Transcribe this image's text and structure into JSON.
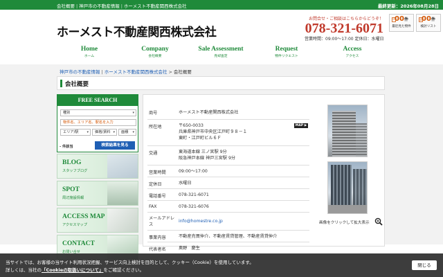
{
  "topbar": {
    "links": [
      "会社概要",
      "神戸市の不動産情報",
      "ホーメスト不動産関西株式会社"
    ],
    "updated": "最終更新：2026年08月28日"
  },
  "header": {
    "logo": "ホーメスト不動産関西株式会社",
    "contact_note": "お問合せ・ご相談はこちらからどうぞ！",
    "tel": "078-321-6071",
    "hours": "営業時間：09:00〜17:00 定休日：水曜日"
  },
  "counters": [
    {
      "num": "00",
      "unit": "件",
      "label": "最近見た物件",
      "icon": "history-icon"
    },
    {
      "num": "00",
      "unit": "件",
      "label": "検討リスト",
      "icon": "list-icon"
    }
  ],
  "gnav": [
    {
      "en": "Home",
      "jp": "ホーム"
    },
    {
      "en": "Company",
      "jp": "会社概要"
    },
    {
      "en": "Sale Assessment",
      "jp": "売却査定"
    },
    {
      "en": "Request",
      "jp": "物件リクエスト"
    },
    {
      "en": "Access",
      "jp": "アクセス"
    }
  ],
  "breadcrumb": {
    "items": [
      "神戸市の不動産情報",
      "ホーメスト不動産関西株式会社"
    ],
    "current": "会社概要"
  },
  "page_title": "会社概要",
  "search": {
    "title": "FREE SEARCH",
    "type_placeholder": "種別",
    "keyword_placeholder": "物件名、エリア名、駅名を入力",
    "area_placeholder": "エリア/駅",
    "price_label": "価格/賃料",
    "size_label": "面積",
    "condition_label": "- 件該当",
    "button": "検索結果を見る"
  },
  "banners": [
    {
      "en": "BLOG",
      "jp": "スタッフブログ"
    },
    {
      "en": "SPOT",
      "jp": "周辺施設情報"
    },
    {
      "en": "ACCESS MAP",
      "jp": "アクセスマップ"
    },
    {
      "en": "CONTACT",
      "jp": "お問い合せ"
    }
  ],
  "company_info": [
    {
      "key": "商号",
      "value": "ホーメスト不動産関西株式会社"
    },
    {
      "key": "所在地",
      "value": "〒650-0033\n兵庫県神戸市中央区江戸町９８－１\n東町・江戸町ビル６Ｆ",
      "map": "MAP"
    },
    {
      "key": "交通",
      "value": "東海道本線 三ノ宮駅 9分\n阪急神戸本線 神戸三宮駅 9分"
    },
    {
      "key": "営業時間",
      "value": "09:00〜17:00"
    },
    {
      "key": "定休日",
      "value": "水曜日"
    },
    {
      "key": "電話番号",
      "value": "078-321-6071"
    },
    {
      "key": "FAX",
      "value": "078-321-6076"
    },
    {
      "key": "メールアドレス",
      "value": "info@homestre.co.jp"
    },
    {
      "key": "事業内容",
      "value": "不動産売買仲介、不動産賃貸管理、不動産賃貸仲介"
    },
    {
      "key": "代表者名",
      "value": "奥野　慶生"
    }
  ],
  "photo_caption": "画像をクリックして拡大表示",
  "cookie": {
    "line1": "当サイトでは、お客様の当サイト利用状況把握、サービス向上検討を目的として、クッキー（Cookie）を使用しています。",
    "line2_pre": "詳しくは、当社の",
    "line2_link": "「Cookieの取扱いについて」",
    "line2_post": "をご確認ください。",
    "close": "閉じる"
  },
  "colors": {
    "brand_green": "#1f8a3a",
    "tel_red": "#c0392b",
    "link_blue": "#1f5fb4"
  }
}
